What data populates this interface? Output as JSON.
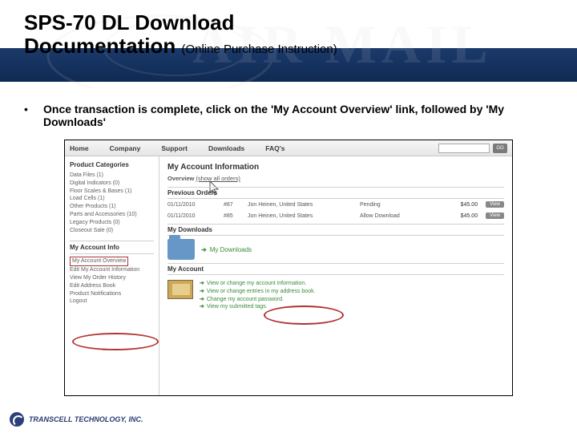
{
  "slide": {
    "title_line1": "SPS-70 DL Download",
    "title_line2": "Documentation",
    "subtitle": "(Online Purchase Instruction)",
    "bullet": "Once transaction is complete, click on the 'My Account Overview' link, followed by 'My Downloads'",
    "footer_brand": "TRANSCELL TECHNOLOGY, INC."
  },
  "screenshot": {
    "nav": [
      "Home",
      "Company",
      "Support",
      "Downloads",
      "FAQ's"
    ],
    "go_label": "GO",
    "sidebar": {
      "categories_header": "Product Categories",
      "categories": [
        "Data Files (1)",
        "Digital Indicators (0)",
        "Floor Scales & Bases (1)",
        "Load Cells (1)",
        "Other Products (1)",
        "Parts and Accessories (10)",
        "Legacy Products (0)",
        "Closeout Sale (0)"
      ],
      "account_header": "My Account Info",
      "account_links": [
        "My Account Overview",
        "Edit My Account Information",
        "View My Order History",
        "Edit Address Book",
        "Product Notifications",
        "Logout"
      ]
    },
    "main": {
      "page_title": "My Account Information",
      "overview_label": "Overview",
      "overview_link": "(show all orders)",
      "previous_orders_header": "Previous Orders",
      "orders": [
        {
          "date": "01/11/2010",
          "num": "#87",
          "who": "Jon Heinen, United States",
          "status": "Pending",
          "price": "$45.00",
          "btn": "View"
        },
        {
          "date": "01/11/2010",
          "num": "#85",
          "who": "Jon Heinen, United States",
          "status": "Allow Download",
          "price": "$45.00",
          "btn": "View"
        }
      ],
      "my_downloads_header": "My Downloads",
      "my_downloads_link": "My Downloads",
      "my_account_header": "My Account",
      "account_action_links": [
        "View or change my account information.",
        "View or change entries in my address book.",
        "Change my account password.",
        "View my submitted tags."
      ]
    }
  }
}
